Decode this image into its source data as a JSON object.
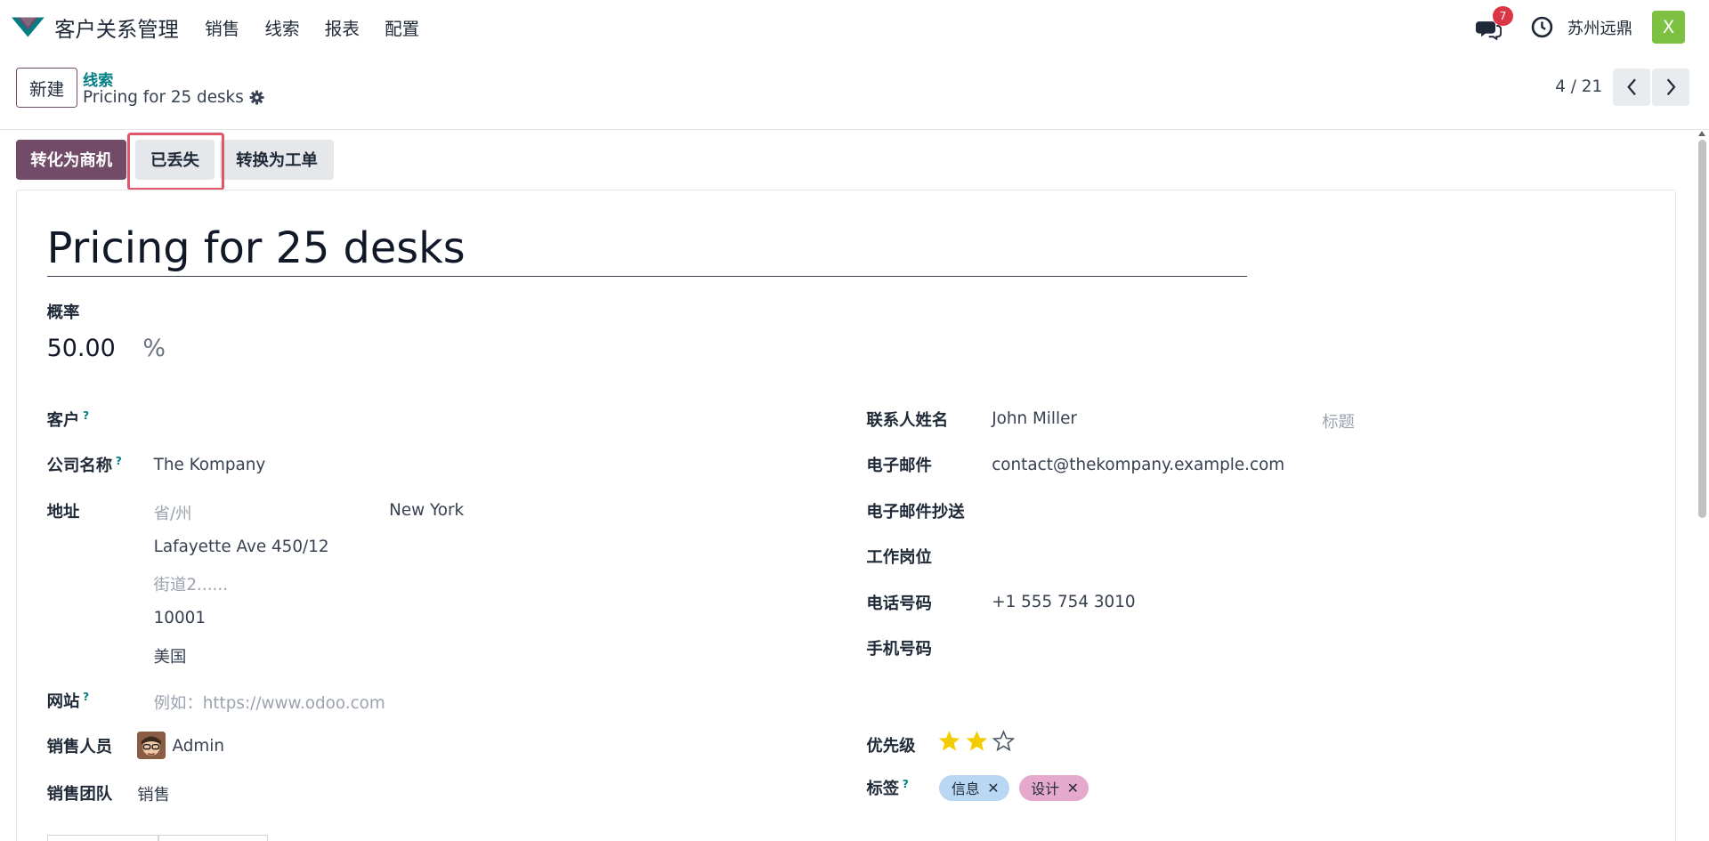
{
  "nav": {
    "app_title": "客户关系管理",
    "items": [
      "销售",
      "线索",
      "报表",
      "配置"
    ],
    "chat_badge": "7",
    "company": "苏州远鼎",
    "user_initial": "X"
  },
  "control": {
    "new_label": "新建",
    "breadcrumb": "线索",
    "record_title": "Pricing for 25 desks",
    "pager": "4 / 21"
  },
  "actions": {
    "convert_opportunity": "转化为商机",
    "lost": "已丢失",
    "convert_ticket": "转换为工单"
  },
  "form": {
    "title": "Pricing for 25 desks",
    "probability_label": "概率",
    "probability": "50.00",
    "percent": "%",
    "customer_label": "客户",
    "company_label": "公司名称",
    "company": "The Kompany",
    "address_label": "地址",
    "state_placeholder": "省/州",
    "city": "New York",
    "street": "Lafayette Ave 450/12",
    "street2_placeholder": "街道2......",
    "zip": "10001",
    "country": "美国",
    "website_label": "网站",
    "website_placeholder": "例如：https://www.odoo.com",
    "salesperson_label": "销售人员",
    "salesperson": "Admin",
    "sales_team_label": "销售团队",
    "sales_team": "销售",
    "contact_label": "联系人姓名",
    "contact": "John Miller",
    "title_placeholder": "标题",
    "email_label": "电子邮件",
    "email": "contact@thekompany.example.com",
    "email_cc_label": "电子邮件抄送",
    "job_label": "工作岗位",
    "phone_label": "电话号码",
    "phone": "+1 555 754 3010",
    "mobile_label": "手机号码",
    "priority_label": "优先级",
    "priority_stars": 2,
    "priority_max": 3,
    "tags_label": "标签",
    "tags": [
      "信息",
      "设计"
    ],
    "help_mark": "?",
    "tag_remove": "✕"
  },
  "colors": {
    "brand": "#714b67",
    "link": "#017e84",
    "star": "#f3cc00",
    "tag_info": "#b9d7f2",
    "tag_design": "#e5a9cb",
    "highlight": "#e0576b"
  }
}
